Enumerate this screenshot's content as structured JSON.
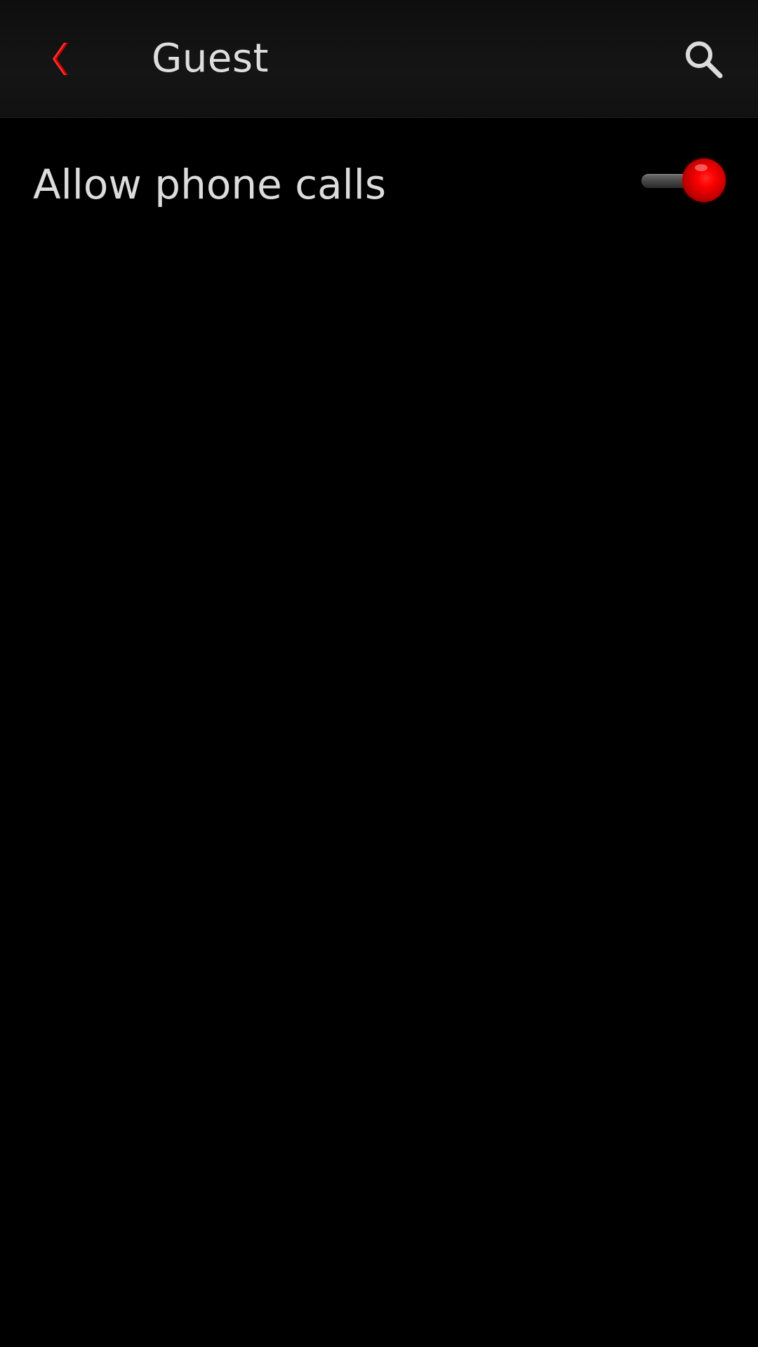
{
  "header": {
    "title": "Guest",
    "back_icon": "chevron-left-icon",
    "search_icon": "search-icon"
  },
  "settings": {
    "rows": [
      {
        "label": "Allow phone calls",
        "enabled": true
      }
    ]
  },
  "colors": {
    "accent": "#ff0000",
    "background": "#000000",
    "header_background": "#141414",
    "text": "#dedede"
  }
}
